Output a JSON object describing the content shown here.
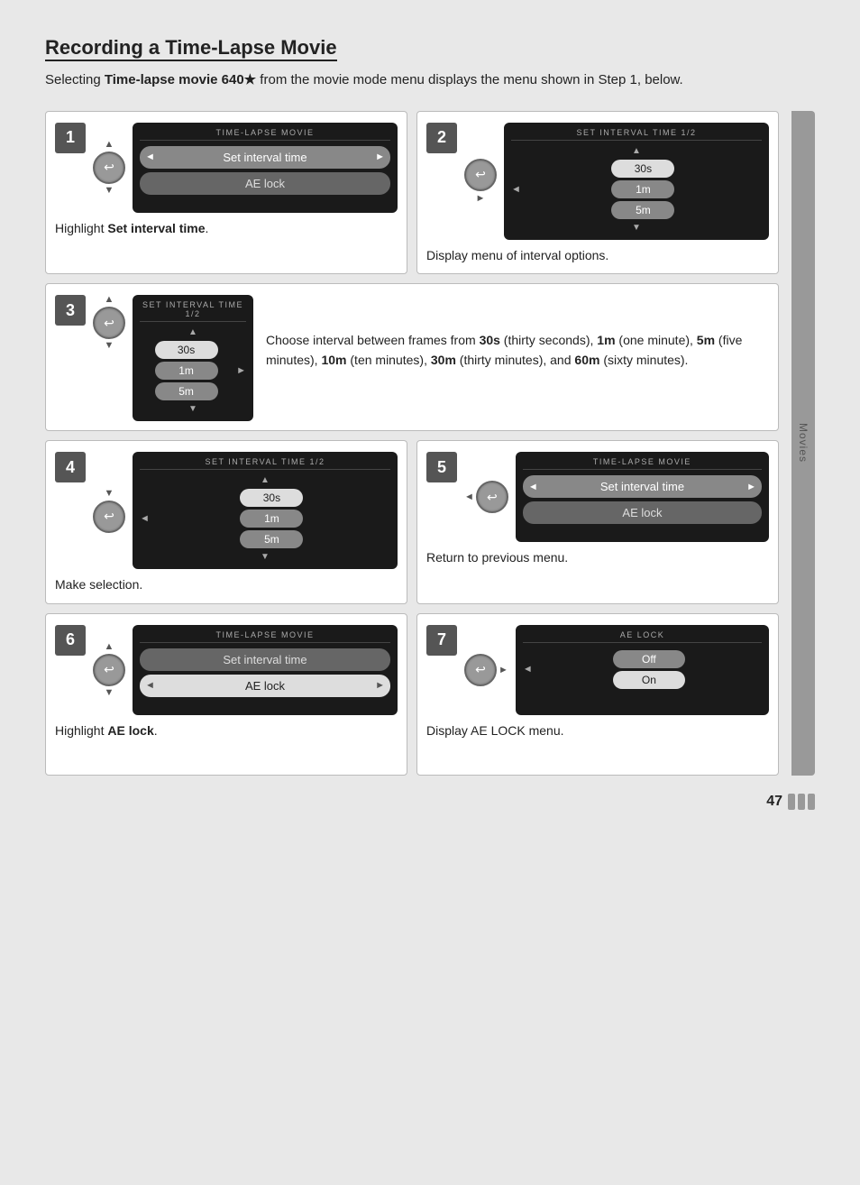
{
  "title": "Recording a Time-Lapse Movie",
  "intro": "Selecting ",
  "intro_bold": "Time-lapse movie 640★",
  "intro_rest": " from the movie mode menu displays the menu shown in Step 1, below.",
  "sidebar_label": "Movies",
  "page_number": "47",
  "steps": [
    {
      "id": "1",
      "screen_title": "TIME-LAPSE MOVIE",
      "menu_items": [
        {
          "label": "Set interval time",
          "selected": false,
          "arrows": true
        },
        {
          "label": "AE lock",
          "selected": false,
          "arrows": false
        }
      ],
      "nav": "ok",
      "nav_arrows": {
        "up": true,
        "down": true,
        "right": false
      },
      "caption": "Highlight ",
      "caption_bold": "Set interval time",
      "caption_end": "."
    },
    {
      "id": "2",
      "screen_title": "SET INTERVAL TIME 1/2",
      "interval_items": [
        {
          "label": "30s",
          "highlight": true
        },
        {
          "label": "1m",
          "highlight": false
        },
        {
          "label": "5m",
          "highlight": false
        }
      ],
      "nav": "ok",
      "nav_arrows": {
        "up": false,
        "down": false,
        "right": true
      },
      "caption": "Display menu of interval options."
    },
    {
      "id": "3",
      "screen_title": "SET INTERVAL TIME 1/2",
      "interval_items": [
        {
          "label": "30s",
          "highlight": true
        },
        {
          "label": "1m",
          "highlight": false
        },
        {
          "label": "5m",
          "highlight": false
        }
      ],
      "nav": "ok",
      "nav_arrows": {
        "up": true,
        "down": true,
        "right": false
      },
      "caption_long": "Choose interval between frames from 30s (thirty seconds), 1m (one minute), 5m (five minutes), 10m (ten minutes), 30m (thirty minutes), and 60m (sixty minutes).",
      "caption_parts": [
        {
          "text": "Choose interval between frames from "
        },
        {
          "bold": "30s"
        },
        {
          "text": " (thirty seconds), "
        },
        {
          "bold": "1m"
        },
        {
          "text": " (one minute), "
        },
        {
          "bold": "5m"
        },
        {
          "text": " (five minutes), "
        },
        {
          "bold": "10m"
        },
        {
          "text": " (ten minutes), "
        },
        {
          "bold": "30m"
        },
        {
          "text": " (thirty minutes), and "
        },
        {
          "bold": "60m"
        },
        {
          "text": " (sixty minutes)."
        }
      ]
    },
    {
      "id": "4",
      "screen_title": "SET INTERVAL TIME 1/2",
      "interval_items": [
        {
          "label": "30s",
          "highlight": true
        },
        {
          "label": "1m",
          "highlight": false
        },
        {
          "label": "5m",
          "highlight": false
        }
      ],
      "nav": "ok_down",
      "nav_arrows": {
        "up": false,
        "down": true,
        "right": false
      },
      "caption": "Make selection."
    },
    {
      "id": "5",
      "screen_title": "TIME-LAPSE MOVIE",
      "menu_items": [
        {
          "label": "Set interval time",
          "selected": false,
          "arrows": true
        },
        {
          "label": "AE lock",
          "selected": false,
          "arrows": false
        }
      ],
      "nav": "ok",
      "nav_arrows": {
        "up": false,
        "down": false,
        "right": false,
        "left": true
      },
      "caption": "Return to previous menu."
    },
    {
      "id": "6",
      "screen_title": "TIME-LAPSE MOVIE",
      "menu_items": [
        {
          "label": "Set interval time",
          "selected": false,
          "arrows": false
        },
        {
          "label": "AE lock",
          "selected": true,
          "arrows": true
        }
      ],
      "nav": "ok",
      "nav_arrows": {
        "up": true,
        "down": true,
        "right": false
      },
      "caption": "Highlight ",
      "caption_bold": "AE lock",
      "caption_end": "."
    },
    {
      "id": "7",
      "screen_title": "AE LOCK",
      "ae_items": [
        {
          "label": "Off",
          "highlight": false
        },
        {
          "label": "On",
          "highlight": true
        }
      ],
      "nav": "ok",
      "nav_arrows": {
        "up": false,
        "down": false,
        "right": true
      },
      "caption": "Display AE LOCK menu."
    }
  ]
}
